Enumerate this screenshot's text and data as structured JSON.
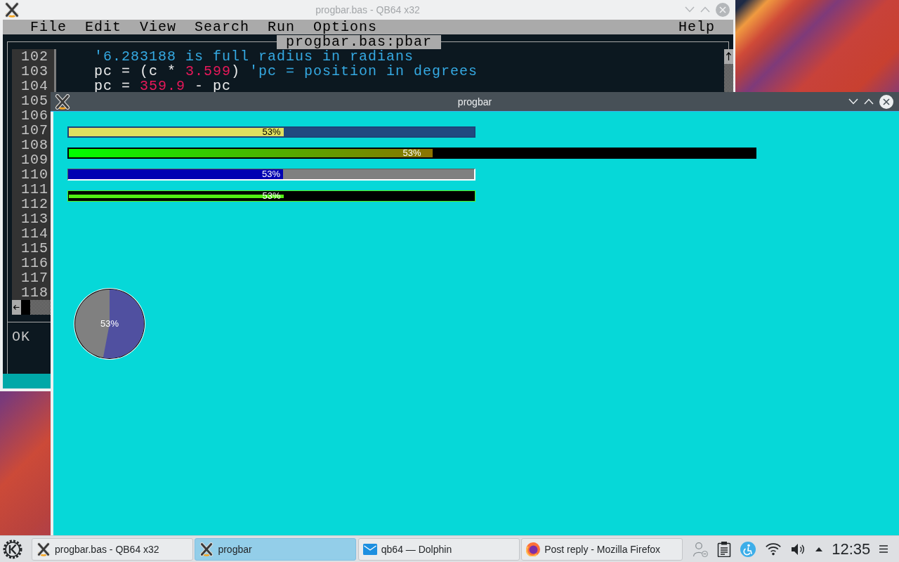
{
  "qb64_window": {
    "title": "progbar.bas - QB64 x32",
    "active": false,
    "menu": [
      "File",
      "Edit",
      "View",
      "Search",
      "Run",
      "Options"
    ],
    "help_menu": "Help",
    "editor": {
      "tab_title": "progbar.bas:pbar",
      "lines": [
        {
          "number": "102",
          "tokens": [
            {
              "kind": "comment",
              "text": "'6.283188 is full radius in radians"
            }
          ]
        },
        {
          "number": "103",
          "tokens": [
            {
              "kind": "plain",
              "text": "pc = (c * "
            },
            {
              "kind": "number",
              "text": "3.599"
            },
            {
              "kind": "plain",
              "text": ") "
            },
            {
              "kind": "comment",
              "text": "'pc = position in degrees"
            }
          ]
        },
        {
          "number": "104",
          "tokens": [
            {
              "kind": "plain",
              "text": "pc = "
            },
            {
              "kind": "number",
              "text": "359.9"
            },
            {
              "kind": "plain",
              "text": " - pc"
            }
          ]
        },
        {
          "number": "105"
        },
        {
          "number": "106"
        },
        {
          "number": "107"
        },
        {
          "number": "108"
        },
        {
          "number": "109"
        },
        {
          "number": "110"
        },
        {
          "number": "111"
        },
        {
          "number": "112"
        },
        {
          "number": "113"
        },
        {
          "number": "114"
        },
        {
          "number": "115"
        },
        {
          "number": "116"
        },
        {
          "number": "117"
        },
        {
          "number": "118"
        }
      ],
      "status": "OK"
    }
  },
  "progbar_window": {
    "title": "progbar",
    "active": true,
    "meters": [
      {
        "kind": "flat",
        "level": 0.53,
        "label": "53%"
      },
      {
        "kind": "gradient",
        "level": 0.53,
        "label": "53%"
      },
      {
        "kind": "sunken",
        "level": 0.53,
        "label": "53%"
      },
      {
        "kind": "line",
        "level": 0.53,
        "label": "53%"
      },
      {
        "kind": "pie",
        "level": 0.53,
        "label": "53%"
      }
    ]
  },
  "taskbar": {
    "tasks": [
      {
        "kind": "qb64",
        "label": "progbar.bas - QB64 x32",
        "selected": false
      },
      {
        "kind": "qb64",
        "label": "progbar",
        "selected": true
      },
      {
        "kind": "folder",
        "label": "qb64 — Dolphin",
        "selected": false
      },
      {
        "kind": "browser",
        "label": "Post reply - Mozilla Firefox",
        "selected": false
      }
    ],
    "clock": "12:35"
  }
}
